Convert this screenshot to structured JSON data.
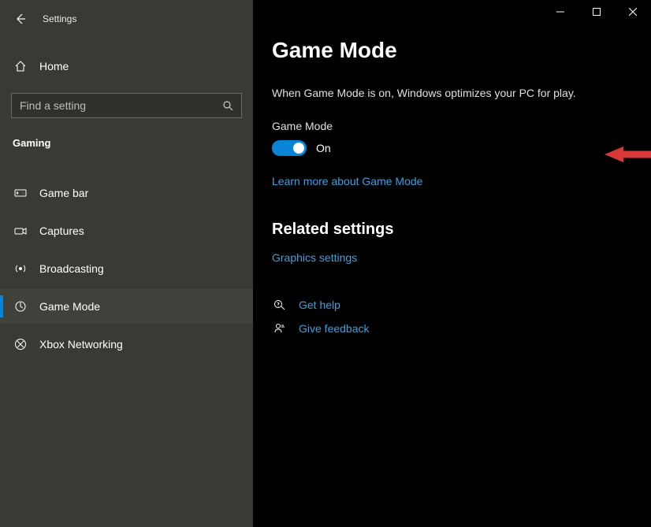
{
  "app": {
    "title": "Settings"
  },
  "sidebar": {
    "home_label": "Home",
    "search_placeholder": "Find a setting",
    "category_label": "Gaming",
    "items": [
      {
        "label": "Game bar",
        "icon": "gamebar"
      },
      {
        "label": "Captures",
        "icon": "captures"
      },
      {
        "label": "Broadcasting",
        "icon": "broadcast"
      },
      {
        "label": "Game Mode",
        "icon": "gamemode"
      },
      {
        "label": "Xbox Networking",
        "icon": "xbox"
      }
    ]
  },
  "main": {
    "title": "Game Mode",
    "description": "When Game Mode is on, Windows optimizes your PC for play.",
    "toggle_label": "Game Mode",
    "toggle_state": "On",
    "learn_more": "Learn more about Game Mode",
    "related_header": "Related settings",
    "related_links": [
      "Graphics settings"
    ],
    "help": {
      "get_help": "Get help",
      "give_feedback": "Give feedback"
    }
  },
  "colors": {
    "accent": "#0a84d6",
    "link": "#3ca0e0",
    "annotation": "#d93838"
  }
}
